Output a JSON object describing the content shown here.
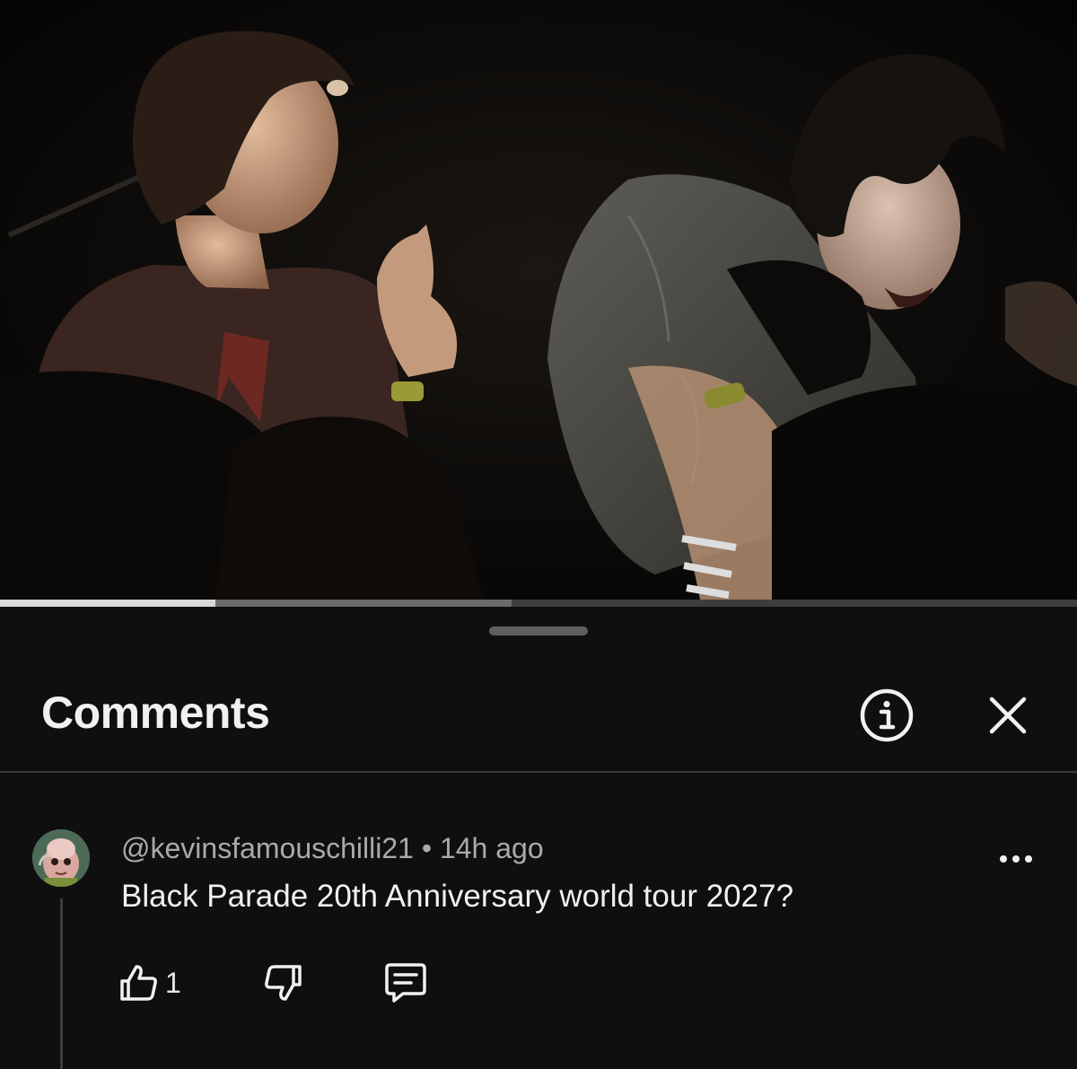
{
  "player": {
    "video": "concert-performance-frame",
    "progress_played": 0.2,
    "progress_buffered": 0.475
  },
  "comments_panel": {
    "title": "Comments",
    "icons": {
      "info": "info-circle-icon",
      "close": "close-icon",
      "more": "more-horizontal-icon",
      "like": "thumb-up-icon",
      "dislike": "thumb-down-icon",
      "reply": "reply-comment-icon"
    },
    "comments": [
      {
        "author": "@kevinsfamouschilli21",
        "separator": "•",
        "time": "14h ago",
        "text": "Black Parade 20th Anniversary world tour 2027?",
        "likes": "1"
      }
    ]
  },
  "colors": {
    "background": "#0f0f0f",
    "text_primary": "#f1f1f1",
    "text_secondary": "#aaaaaa",
    "progress_played": "#d8d8d8"
  }
}
